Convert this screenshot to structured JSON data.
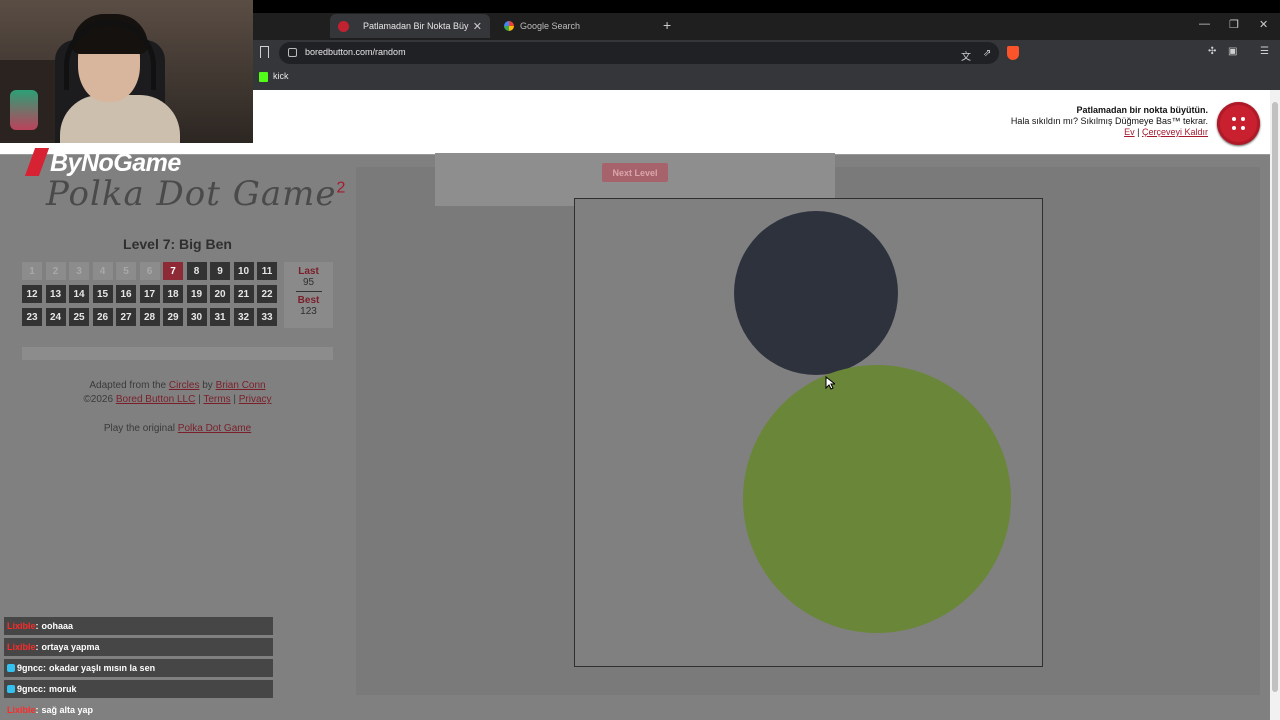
{
  "browser": {
    "tabs": [
      {
        "label": "Patlamadan Bir Nokta Büyütü",
        "active": true
      },
      {
        "label": "Google Search",
        "active": false
      }
    ],
    "url": "boredbutton.com/random",
    "bookmark_label": "kick"
  },
  "header": {
    "title": "Patlamadan bir nokta büyütün.",
    "subtitle": "Hala sıkıldın mı? Sıkılmış Düğmeye Bas™ tekrar.",
    "link_home": "Ev",
    "separator": "|",
    "link_remove_frame": "Çerçeveyi Kaldır"
  },
  "game": {
    "logo_brand": "ByNoGame",
    "logo_title": "Polka Dot Game",
    "logo_superscript": "2",
    "level_title": "Level 7: Big Ben",
    "levels": [
      "1",
      "2",
      "3",
      "4",
      "5",
      "6",
      "7",
      "8",
      "9",
      "10",
      "11",
      "12",
      "13",
      "14",
      "15",
      "16",
      "17",
      "18",
      "19",
      "20",
      "21",
      "22",
      "23",
      "24",
      "25",
      "26",
      "27",
      "28",
      "29",
      "30",
      "31",
      "32",
      "33"
    ],
    "completed_levels": 6,
    "current_level": 7,
    "score": {
      "last_label": "Last",
      "last_value": "95",
      "best_label": "Best",
      "best_value": "123"
    },
    "progress": 0,
    "next_level_label": "Next Level",
    "colors": {
      "dark_dot": "#2e323d",
      "green_dot": "#6a8638",
      "accent": "#a31a2e"
    }
  },
  "credits": {
    "adapted_prefix": "Adapted from the",
    "circles_link": "Circles",
    "by_word": "by",
    "author_link": "Brian Conn",
    "copyright": "©2026",
    "company_link": "Bored Button LLC",
    "sep1": "|",
    "terms_link": "Terms",
    "sep2": "|",
    "privacy_link": "Privacy",
    "play_prefix": "Play the original",
    "original_link": "Polka Dot Game"
  },
  "chat": [
    {
      "user": "Lixible",
      "message": "oohaaa",
      "user_color": "#ff2a2a"
    },
    {
      "user": "Lixible",
      "message": "ortaya yapma",
      "user_color": "#ff2a2a"
    },
    {
      "user": "9gncc",
      "message": "okadar yaşlı mısın la sen",
      "user_color": "#ffffff"
    },
    {
      "user": "9gncc",
      "message": "moruk",
      "user_color": "#ffffff"
    },
    {
      "user": "Lixible",
      "message": "sağ alta yap",
      "user_color": "#ff2a2a"
    }
  ]
}
